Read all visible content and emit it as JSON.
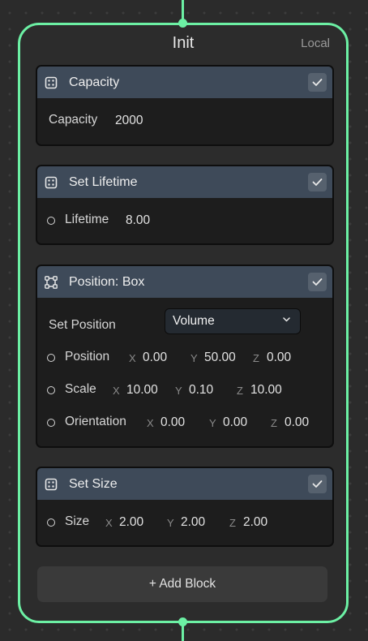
{
  "context": {
    "title": "Init",
    "space": "Local"
  },
  "colors": {
    "accent": "#6cf0a4",
    "block_header": "#3e4a59",
    "block_body": "#1d1d1d"
  },
  "blocks": [
    {
      "title": "Capacity",
      "icon": "dice-icon",
      "enabled": true,
      "fields": [
        {
          "label": "Capacity",
          "value": "2000"
        }
      ]
    },
    {
      "title": "Set Lifetime",
      "icon": "dice-icon",
      "enabled": true,
      "fields": [
        {
          "label": "Lifetime",
          "value": "8.00"
        }
      ]
    },
    {
      "title": "Position: Box",
      "icon": "box-shape-icon",
      "enabled": true,
      "set_position_label": "Set Position",
      "set_position_value": "Volume",
      "vectors": [
        {
          "label": "Position",
          "x": "0.00",
          "y": "50.00",
          "z": "0.00"
        },
        {
          "label": "Scale",
          "x": "10.00",
          "y": "0.10",
          "z": "10.00"
        },
        {
          "label": "Orientation",
          "x": "0.00",
          "y": "0.00",
          "z": "0.00"
        }
      ]
    },
    {
      "title": "Set Size",
      "icon": "dice-icon",
      "enabled": true,
      "vectors": [
        {
          "label": "Size",
          "x": "2.00",
          "y": "2.00",
          "z": "2.00"
        }
      ]
    }
  ],
  "axes": {
    "x": "X",
    "y": "Y",
    "z": "Z"
  },
  "add_block_label": "+ Add Block"
}
